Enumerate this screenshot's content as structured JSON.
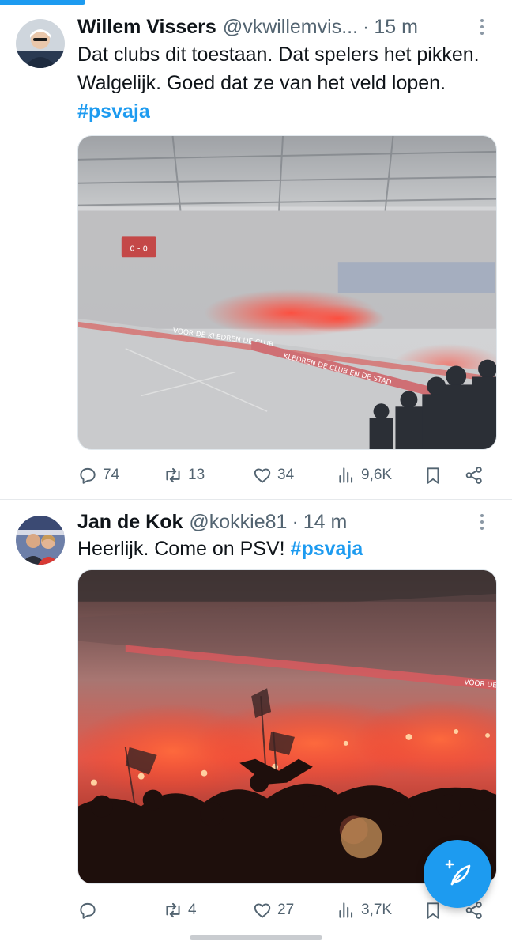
{
  "colors": {
    "accent": "#1d9bf0",
    "muted": "#536471",
    "text": "#0f1419"
  },
  "tweets": [
    {
      "name": "Willem Vissers",
      "handle": "@vkwillemvis...",
      "dot": "·",
      "time": "15 m",
      "text_main": "Dat clubs dit toestaan. Dat spelers het pikken. Walgelijk. Goed dat ze van het veld lopen. ",
      "hashtag": "#psvaja",
      "media_text": {
        "banner1": "VOOR DE KLEDREN DE CLUB",
        "banner2": "KLEDREN DE CLUB EN DE STAD",
        "scoreboard": "0 - 0"
      },
      "stats": {
        "replies": "74",
        "reposts": "13",
        "likes": "34",
        "views": "9,6K"
      },
      "icons": [
        "reply-icon",
        "repost-icon",
        "like-icon",
        "views-icon",
        "bookmark-icon",
        "share-icon"
      ]
    },
    {
      "name": "Jan de Kok",
      "handle": "@kokkie81",
      "dot": "·",
      "time": "14 m",
      "text_main": "Heerlijk. Come on PSV! ",
      "hashtag": "#psvaja",
      "media_text": {
        "banner1": "VOOR DE"
      },
      "stats": {
        "replies": "",
        "reposts": "4",
        "likes": "27",
        "views": "3,7K"
      },
      "icons": [
        "reply-icon",
        "repost-icon",
        "like-icon",
        "views-icon",
        "bookmark-icon",
        "share-icon"
      ]
    }
  ],
  "fab": {
    "icon": "compose-feather-icon"
  }
}
